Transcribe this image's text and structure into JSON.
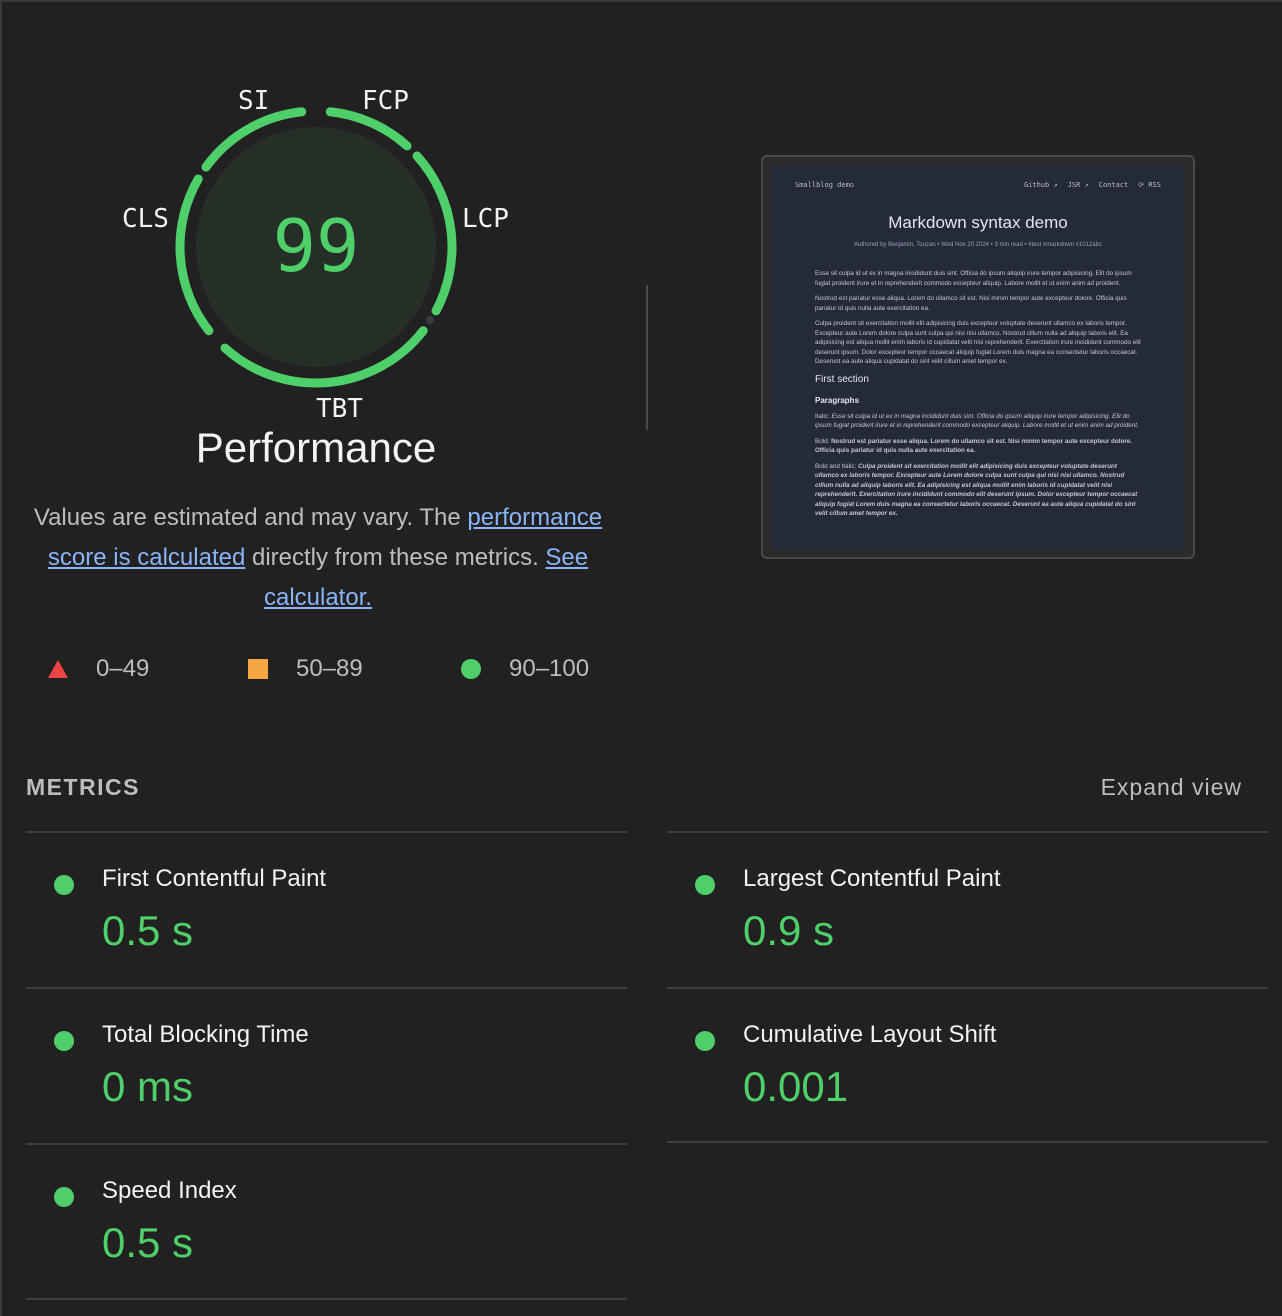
{
  "gauge": {
    "score": "99",
    "title": "Performance",
    "labels": {
      "si": "SI",
      "fcp": "FCP",
      "lcp": "LCP",
      "tbt": "TBT",
      "cls": "CLS"
    },
    "color": "#4fcf6a"
  },
  "description": {
    "text1": "Values are estimated and may vary. The ",
    "link1": "performance score is calculated",
    "text2": " directly from these metrics. ",
    "link2": "See calculator."
  },
  "legend": {
    "fail": "0–49",
    "average": "50–89",
    "pass": "90–100",
    "colors": {
      "fail": "#ef4444",
      "average": "#f5a742",
      "pass": "#4fcf6a"
    }
  },
  "thumbnail": {
    "brand": "Smallblog demo",
    "nav": [
      "Github ↗",
      "JSR ↗",
      "Contact",
      "⟳ RSS"
    ],
    "title": "Markdown syntax demo",
    "meta": "Authored by Benjamin, Touzan  •  Wed Nov 20 2024  •  3 min read  •  #test  #markdown  #1012abc",
    "p1": "Esse sit culpa id ut ex in magna incididunt duis sint. Officia do ipsum aliquip irure tempor adipisicing. Elit do ipsum fugiat proident irure et in reprehenderit commodo excepteur aliquip. Labore mollit et ut enim anim ad proident.",
    "p2": "Nostrud est pariatur esse aliqua. Lorem do ullamco sit est. Nisi minim tempor aute excepteur dolore. Officia quis pariatur id quis nulla aute exercitation ea.",
    "p3": "Culpa proident sit exercitation mollit elit adipisicing duis excepteur voluptate deserunt ullamco ex laboris tempor. Excepteur aute Lorem dolore culpa sunt culpa qui nisi nisi ullamco. Nostrud cillum nulla ad aliquip laboris elit. Ea adipisicing est aliqua mollit enim laboris id cupidatat velit nisi reprehenderit. Exercitation irure incididunt commodo elit deserunt ipsum. Dolor excepteur tempor occaecat aliquip fugiat Lorem duis magna ea consectetur laboris occaecat. Deserunt ea aute aliqua cupidatat do sint velit cillum amet tempor ex.",
    "h2": "First section",
    "h3": "Paragraphs",
    "p4_label": "Italic: ",
    "p4": "Esse sit culpa id ut ex in magna incididunt duis sint. Officia do ipsum aliquip irure tempor adipisicing. Elit do ipsum fugiat proident irure et in reprehenderit commodo excepteur aliquip. Labore mollit et ut enim anim ad proident.",
    "p5_label": "Bold: ",
    "p5": "Nostrud est pariatur esse aliqua. Lorem do ullamco sit est. Nisi minim tempor aute excepteur dolore. Officia quis pariatur id quis nulla aute exercitation ea.",
    "p6_label": "Bold and Italic: ",
    "p6": "Culpa proident sit exercitation mollit elit adipisicing duis excepteur voluptate deserunt ullamco ex laboris tempor. Excepteur aute Lorem dolore culpa sunt culpa qui nisi nisi ullamco. Nostrud cillum nulla ad aliquip laboris elit. Ea adipisicing est aliqua mollit enim laboris id cupidatat velit nisi reprehenderit. Exercitation irure incididunt commodo elit deserunt ipsum. Dolor excepteur tempor occaecat aliquip fugiat Lorem duis magna ea consectetur laboris occaecat. Deserunt ea aute aliqua cupidatat do sint velit cillum amet tempor ex."
  },
  "metrics": {
    "title": "METRICS",
    "expand_label": "Expand view",
    "items": [
      {
        "label": "First Contentful Paint",
        "value": "0.5 s"
      },
      {
        "label": "Largest Contentful Paint",
        "value": "0.9 s"
      },
      {
        "label": "Total Blocking Time",
        "value": "0 ms"
      },
      {
        "label": "Cumulative Layout Shift",
        "value": "0.001"
      },
      {
        "label": "Speed Index",
        "value": "0.5 s"
      }
    ]
  }
}
